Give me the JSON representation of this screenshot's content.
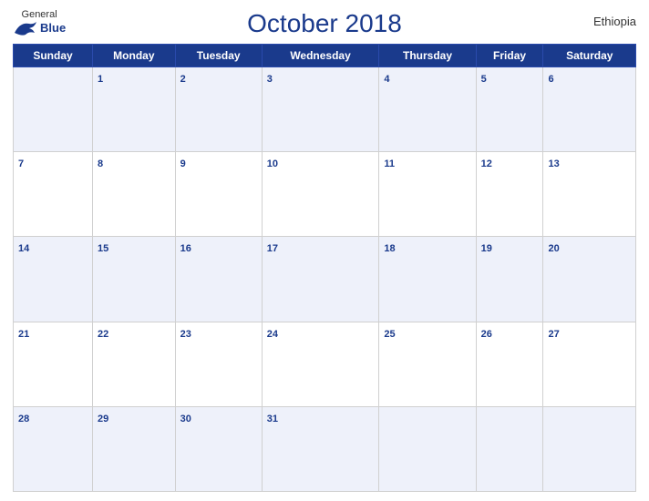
{
  "header": {
    "logo": {
      "general": "General",
      "blue": "Blue",
      "bird_unicode": "🐦"
    },
    "title": "October 2018",
    "country": "Ethiopia"
  },
  "weekdays": [
    "Sunday",
    "Monday",
    "Tuesday",
    "Wednesday",
    "Thursday",
    "Friday",
    "Saturday"
  ],
  "weeks": [
    [
      null,
      1,
      2,
      3,
      4,
      5,
      6
    ],
    [
      7,
      8,
      9,
      10,
      11,
      12,
      13
    ],
    [
      14,
      15,
      16,
      17,
      18,
      19,
      20
    ],
    [
      21,
      22,
      23,
      24,
      25,
      26,
      27
    ],
    [
      28,
      29,
      30,
      31,
      null,
      null,
      null
    ]
  ]
}
